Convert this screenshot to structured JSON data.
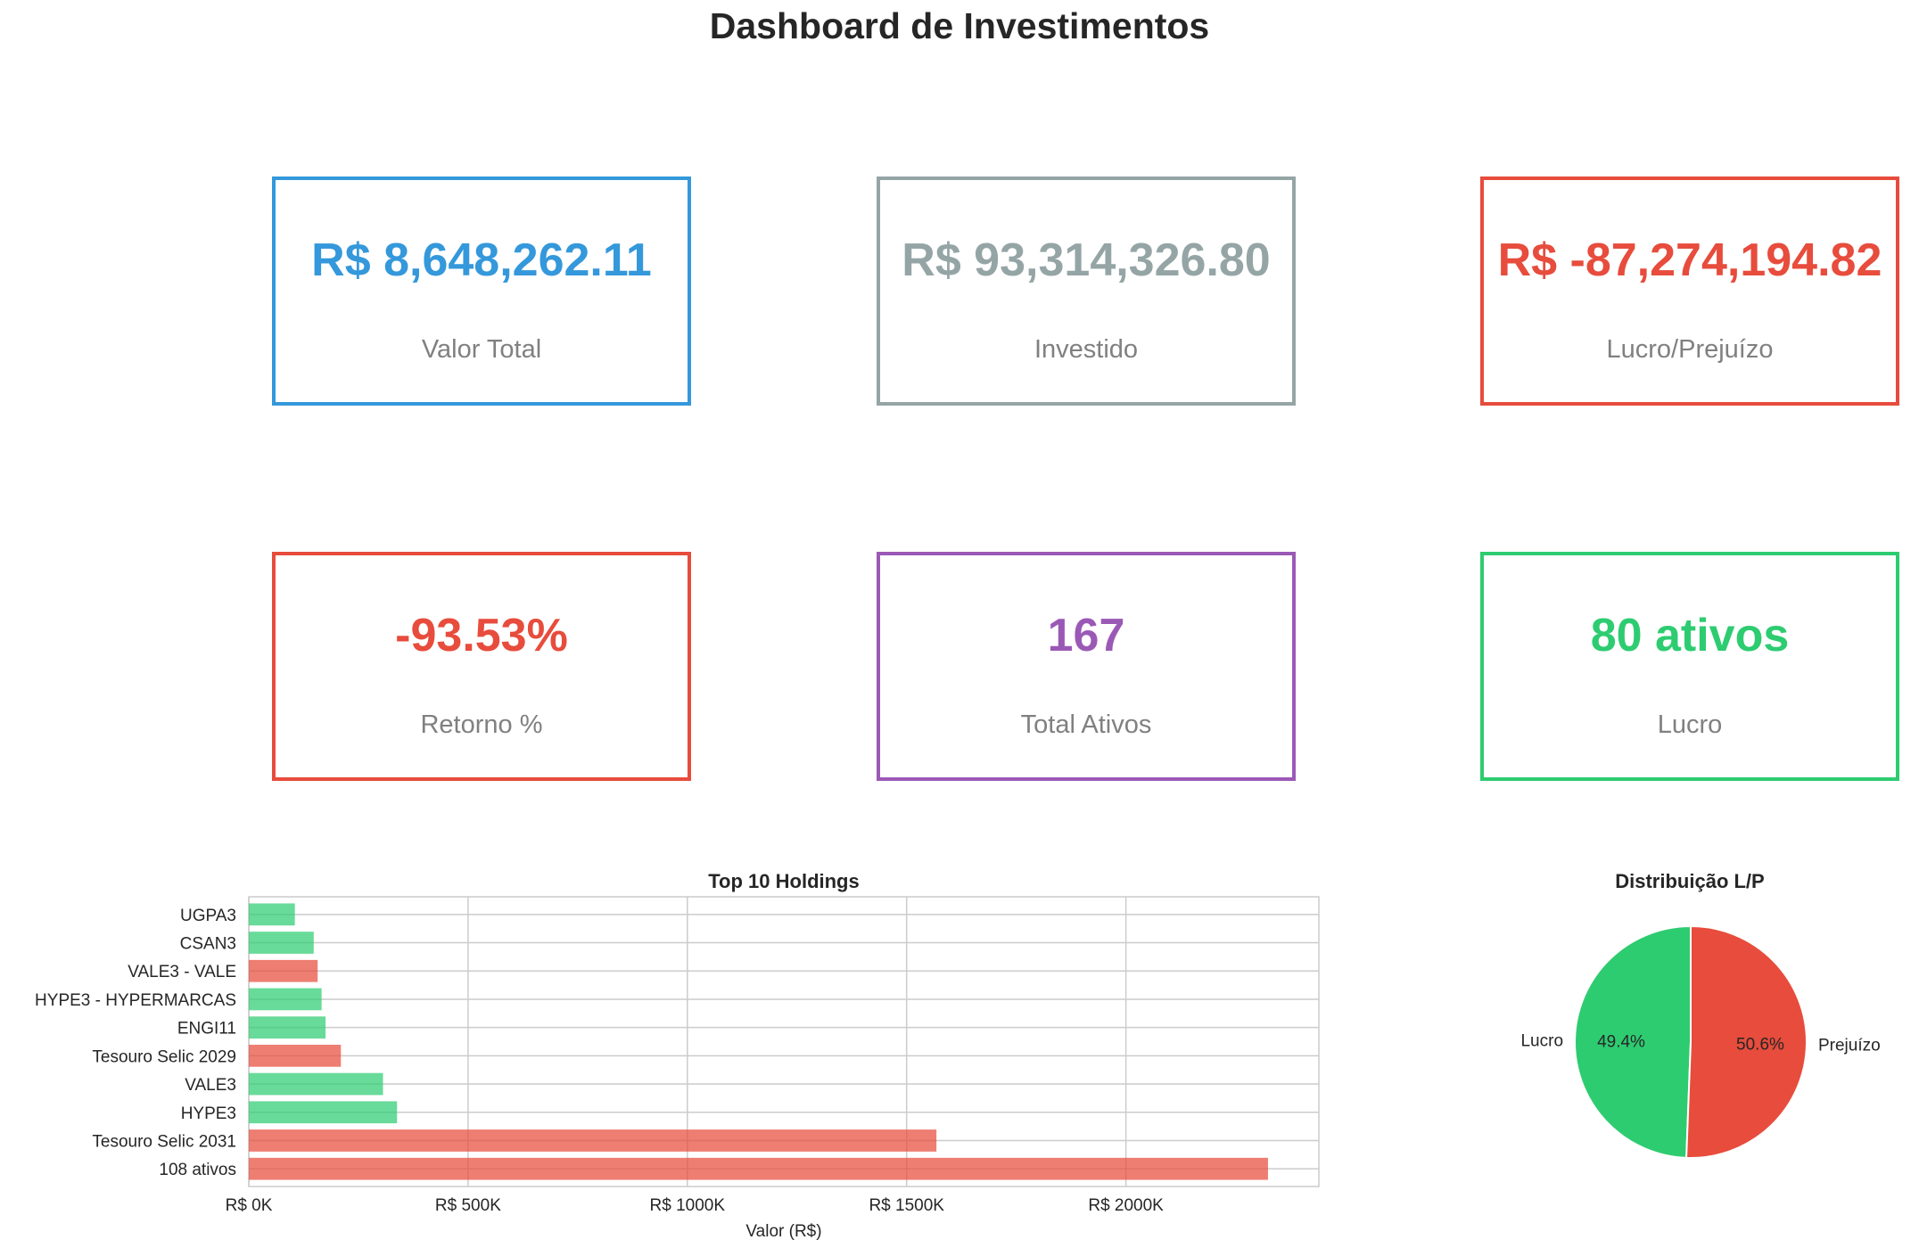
{
  "page": {
    "title": "Dashboard de Investimentos"
  },
  "cards": [
    {
      "value": "R$ 8,648,262.11",
      "label": "Valor Total",
      "color": "#3498db"
    },
    {
      "value": "R$ 93,314,326.80",
      "label": "Investido",
      "color": "#95a5a6"
    },
    {
      "value": "R$ -87,274,194.82",
      "label": "Lucro/Prejuízo",
      "color": "#e74c3c"
    },
    {
      "value": "-93.53%",
      "label": "Retorno %",
      "color": "#e74c3c"
    },
    {
      "value": "167",
      "label": "Total Ativos",
      "color": "#9b59b6"
    },
    {
      "value": "80 ativos",
      "label": "Lucro",
      "color": "#2ecc71"
    }
  ],
  "chart_data": [
    {
      "type": "bar",
      "orientation": "horizontal",
      "title": "Top 10 Holdings",
      "xlabel": "Valor (R$)",
      "ylabel": "",
      "xlim": [
        0,
        2440000
      ],
      "grid": true,
      "xticks": [
        {
          "value": 0,
          "label": "R$ 0K"
        },
        {
          "value": 500000,
          "label": "R$ 500K"
        },
        {
          "value": 1000000,
          "label": "R$ 1000K"
        },
        {
          "value": 1500000,
          "label": "R$ 1500K"
        },
        {
          "value": 2000000,
          "label": "R$ 2000K"
        }
      ],
      "categories": [
        "UGPA3",
        "CSAN3",
        "VALE3 - VALE",
        "HYPE3 - HYPERMARCAS",
        "ENGI11",
        "Tesouro Selic 2029",
        "VALE3",
        "HYPE3",
        "Tesouro Selic 2031",
        "108 ativos"
      ],
      "values": [
        105000,
        148000,
        157000,
        166000,
        175000,
        210000,
        306000,
        338000,
        1568000,
        2324000
      ],
      "bar_status": [
        "profit",
        "profit",
        "loss",
        "profit",
        "profit",
        "loss",
        "profit",
        "profit",
        "loss",
        "loss"
      ],
      "colors": {
        "profit": "#2ecc71",
        "loss": "#e74c3c"
      }
    },
    {
      "type": "pie",
      "title": "Distribuição L/P",
      "slices": [
        {
          "label": "Lucro",
          "value": 49.4,
          "pct_label": "49.4%",
          "color": "#2ecc71"
        },
        {
          "label": "Prejuízo",
          "value": 50.6,
          "pct_label": "50.6%",
          "color": "#e74c3c"
        }
      ]
    }
  ]
}
